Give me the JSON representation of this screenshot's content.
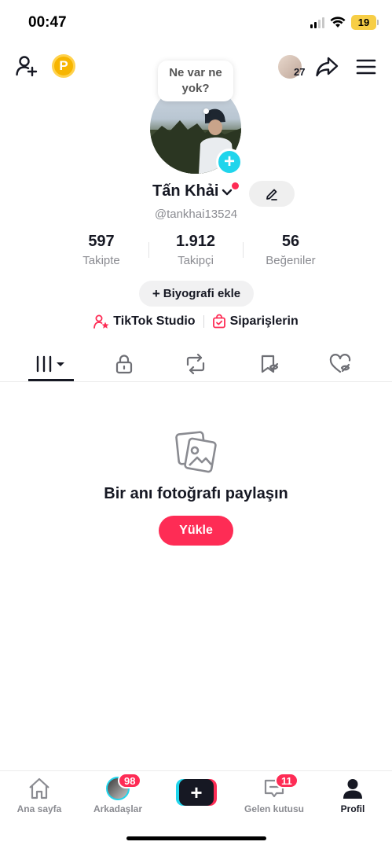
{
  "status_bar": {
    "time": "00:47",
    "battery": "19"
  },
  "top_bar": {
    "coin_letter": "P",
    "friends_count": "27"
  },
  "note_bubble": {
    "text": "Ne var ne yok?"
  },
  "profile": {
    "name": "Tấn Khải",
    "username": "@tankhai13524"
  },
  "stats": [
    {
      "value": "597",
      "label": "Takipte"
    },
    {
      "value": "1.912",
      "label": "Takipçi"
    },
    {
      "value": "56",
      "label": "Beğeniler"
    }
  ],
  "bio_button": {
    "label": "Biyografi ekle"
  },
  "links": {
    "studio": "TikTok Studio",
    "orders": "Siparişlerin"
  },
  "empty_state": {
    "title": "Bir anı fotoğrafı paylaşın",
    "upload_label": "Yükle"
  },
  "bottom_nav": {
    "home": "Ana sayfa",
    "friends": "Arkadaşlar",
    "friends_badge": "98",
    "inbox": "Gelen kutusu",
    "inbox_badge": "11",
    "profile": "Profil"
  },
  "colors": {
    "accent": "#fe2c55",
    "cyan": "#20d5ec",
    "text": "#161823",
    "muted": "#8a8b91"
  }
}
